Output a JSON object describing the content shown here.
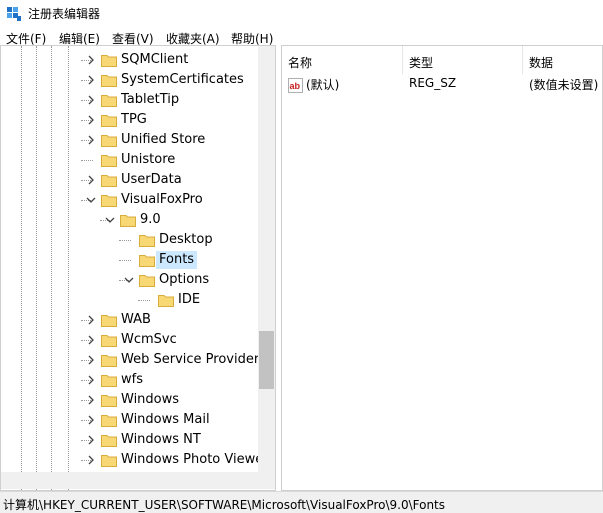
{
  "window": {
    "title": "注册表编辑器"
  },
  "menu": [
    "文件(F)",
    "编辑(E)",
    "查看(V)",
    "收藏夹(A)",
    "帮助(H)"
  ],
  "tree": {
    "items": [
      {
        "label": "SQMClient",
        "expandable": true
      },
      {
        "label": "SystemCertificates",
        "expandable": true
      },
      {
        "label": "TabletTip",
        "expandable": true
      },
      {
        "label": "TPG",
        "expandable": true
      },
      {
        "label": "Unified Store",
        "expandable": true
      },
      {
        "label": "Unistore",
        "expandable": false
      },
      {
        "label": "UserData",
        "expandable": true
      },
      {
        "label": "VisualFoxPro",
        "expandable": true,
        "expanded": true
      },
      {
        "label": "9.0",
        "expandable": true,
        "expanded": true
      },
      {
        "label": "Desktop",
        "expandable": false
      },
      {
        "label": "Fonts",
        "expandable": false,
        "selected": true
      },
      {
        "label": "Options",
        "expandable": true,
        "expanded": true
      },
      {
        "label": "IDE",
        "expandable": false
      },
      {
        "label": "WAB",
        "expandable": true
      },
      {
        "label": "WcmSvc",
        "expandable": true
      },
      {
        "label": "Web Service Providers",
        "expandable": true
      },
      {
        "label": "wfs",
        "expandable": true
      },
      {
        "label": "Windows",
        "expandable": true
      },
      {
        "label": "Windows Mail",
        "expandable": true
      },
      {
        "label": "Windows NT",
        "expandable": true
      },
      {
        "label": "Windows Photo Viewer",
        "expandable": true
      }
    ]
  },
  "values": {
    "columns": [
      "名称",
      "类型",
      "数据"
    ],
    "rows": [
      {
        "name": "(默认)",
        "type": "REG_SZ",
        "data": "(数值未设置)",
        "icon": "string-value-icon"
      }
    ]
  },
  "status": {
    "path": "计算机\\HKEY_CURRENT_USER\\SOFTWARE\\Microsoft\\VisualFoxPro\\9.0\\Fonts"
  },
  "colors": {
    "folder": "#f8d775",
    "folder_edge": "#d9ad3c",
    "selection": "#cce8ff",
    "accent": "#0078d7"
  }
}
